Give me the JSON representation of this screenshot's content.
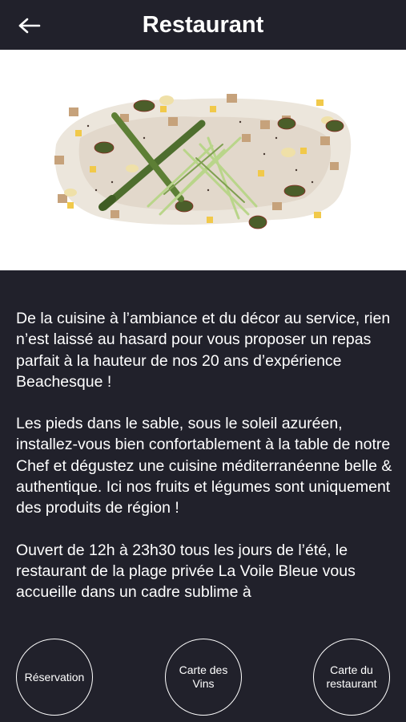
{
  "header": {
    "title": "Restaurant",
    "back_icon": "arrow-left-icon"
  },
  "hero": {
    "image_description_icon": "dish-photo"
  },
  "content": {
    "paragraphs": [
      "De la cuisine à l’ambiance et du décor au service, rien n’est laissé au hasard pour vous proposer un repas parfait à la hauteur de nos 20 ans d’expérience Beachesque !",
      "Les pieds dans le sable, sous le soleil azuréen, installez-vous bien confortablement à la table de notre Chef et dégustez une cuisine méditerranéenne belle & authentique. Ici nos fruits et légumes sont uniquement des produits de région !",
      "Ouvert de 12h à 23h30 tous les jours de l’été, le restaurant de la plage privée La Voile Bleue vous accueille dans un cadre sublime à"
    ]
  },
  "actions": {
    "reservation": "Réservation",
    "wine_list": "Carte des Vins",
    "menu": "Carte du restaurant"
  },
  "colors": {
    "background": "#21212b",
    "text": "#ffffff"
  }
}
